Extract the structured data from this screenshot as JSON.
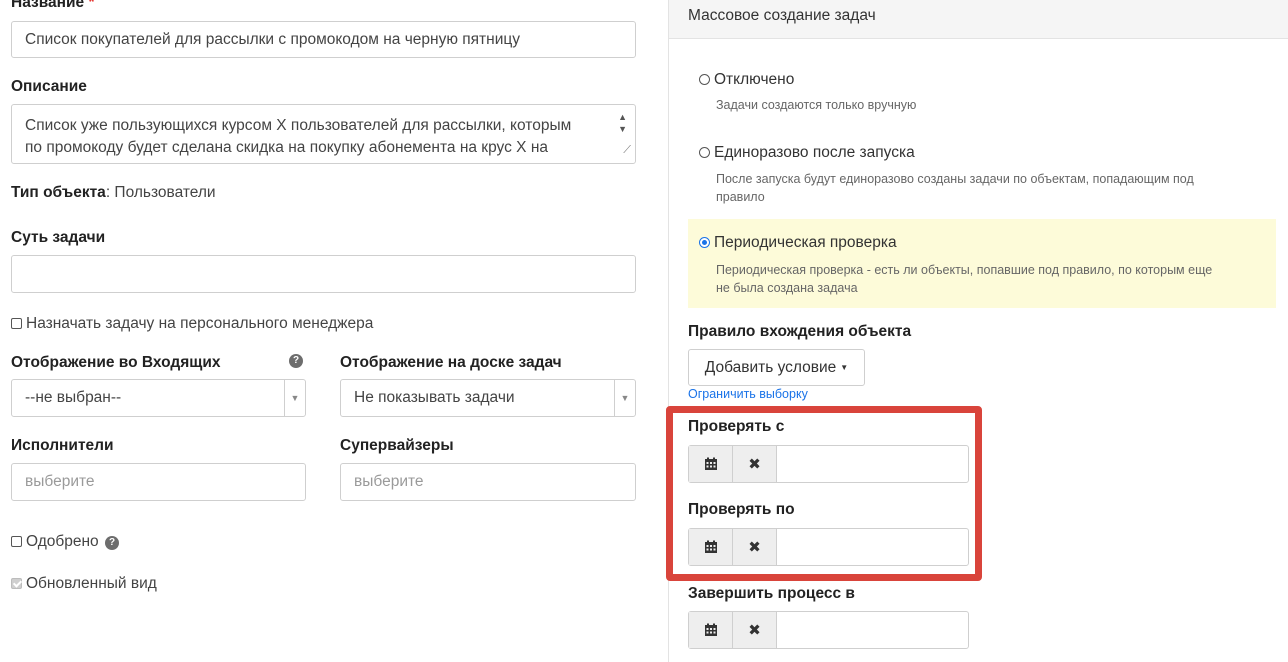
{
  "form": {
    "name_label": "Название",
    "required_mark": "*",
    "name_value": "Список покупателей для рассылки с промокодом на черную пятницу",
    "description_label": "Описание",
    "description_line1": "Список уже пользующихся курсом X пользователей для рассылки, которым",
    "description_line2": "по промокоду будет сделана скидка на покупку абонемента на крус X на",
    "object_type_label": "Тип объекта",
    "object_type_value": ": Пользователи",
    "task_essence_label": "Суть задачи",
    "task_essence_value": "",
    "assign_manager_label": "Назначать задачу на персонального менеджера",
    "inbox_display_label": "Отображение во Входящих",
    "inbox_display_value": "--не выбран--",
    "board_display_label": "Отображение на доске задач",
    "board_display_value": "Не показывать задачи",
    "executors_label": "Исполнители",
    "executors_placeholder": "выберите",
    "supervisors_label": "Супервайзеры",
    "supervisors_placeholder": "выберите",
    "approved_label": "Одобрено",
    "updated_view_label": "Обновленный вид",
    "help_glyph": "?"
  },
  "mass": {
    "title": "Массовое создание задач",
    "options": [
      {
        "label": "Отключено",
        "hint": "Задачи создаются только вручную",
        "selected": false
      },
      {
        "label": "Единоразово после запуска",
        "hint_line1": "После запуска будут единоразово созданы задачи по объектам, попадающим под",
        "hint_line2": "правило",
        "selected": false
      },
      {
        "label": "Периодическая проверка",
        "hint_line1": "Периодическая проверка - есть ли объекты, попавшие под правило, по которым еще",
        "hint_line2": "не была создана задача",
        "selected": true
      }
    ],
    "rule_label": "Правило вхождения объекта",
    "add_condition": "Добавить условие",
    "limit_selection": "Ограничить выборку",
    "check_from_label": "Проверять с",
    "check_to_label": "Проверять по",
    "finish_label": "Завершить процесс в",
    "clear_glyph": "✖"
  },
  "colors": {
    "highlight_bg": "#fdfbd9",
    "annotation_border": "#d9443b",
    "link": "#1a73e8"
  }
}
